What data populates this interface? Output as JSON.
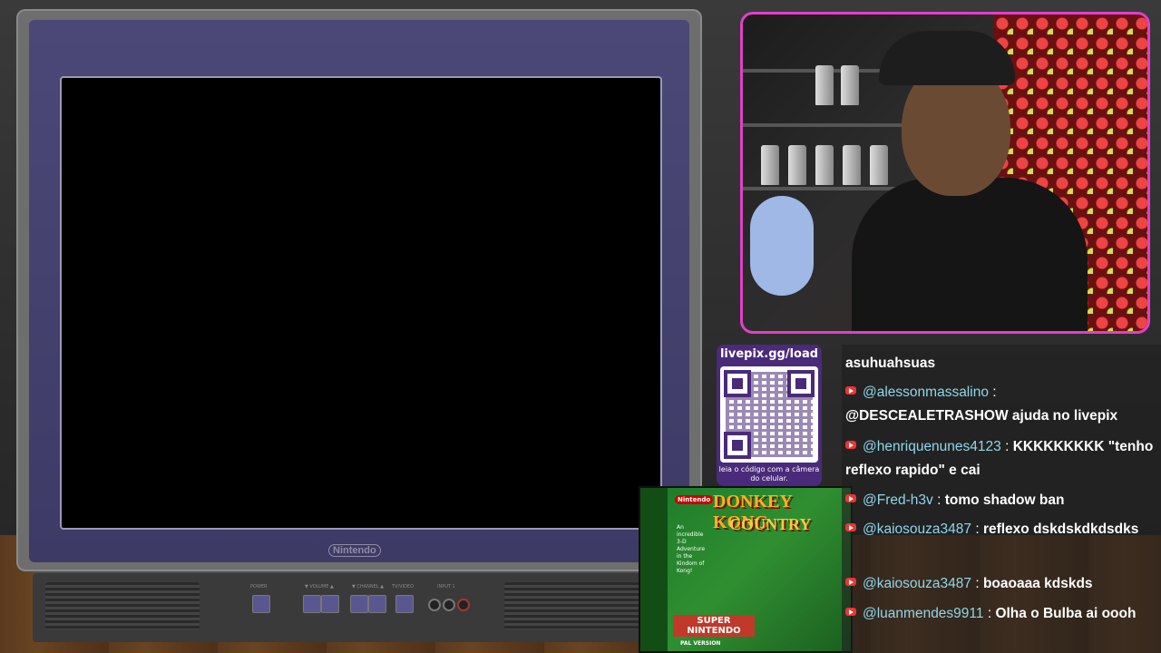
{
  "tv": {
    "brand": "Nintendo"
  },
  "tv_controls": {
    "power": "POWER",
    "volume": "▼ VOLUME ▲",
    "channel": "▼ CHANNEL ▲",
    "tv_video": "TV/VIDEO",
    "input": "INPUT 1"
  },
  "qr": {
    "url": "livepix.gg/load",
    "caption": "leia o código com a câmera do celular."
  },
  "gamebox": {
    "publisher": "Nintendo",
    "title_line1": "DONKEY KONG",
    "title_line2": "COUNTRY",
    "blurb": "An incredible 3-D Adventure in the Kindom of Kong!",
    "platform": "SUPER NINTENDO",
    "region": "PAL VERSION"
  },
  "chat": {
    "messages": [
      {
        "user": "",
        "text": "asuhuahsuas"
      },
      {
        "user": "@alessonmassalino",
        "text": "@DESCEALETRASHOW ajuda no livepix"
      },
      {
        "user": "@henriquenunes4123",
        "text": "KKKKKKKKK \"tenho reflexo rapido\" e cai"
      },
      {
        "user": "@Fred-h3v",
        "text": "tomo shadow ban"
      },
      {
        "user": "@kaiosouza3487",
        "text": "reflexo dskdskdkdsdks"
      },
      {
        "user": "@kaiosouza3487",
        "text": "boaoaaa kdskds"
      },
      {
        "user": "@luanmendes9911",
        "text": "Olha o Bulba ai oooh"
      }
    ]
  },
  "colors": {
    "webcam_border": "#e040c8",
    "username": "#8fd6ea",
    "qr_bg": "#4a2a7a"
  }
}
